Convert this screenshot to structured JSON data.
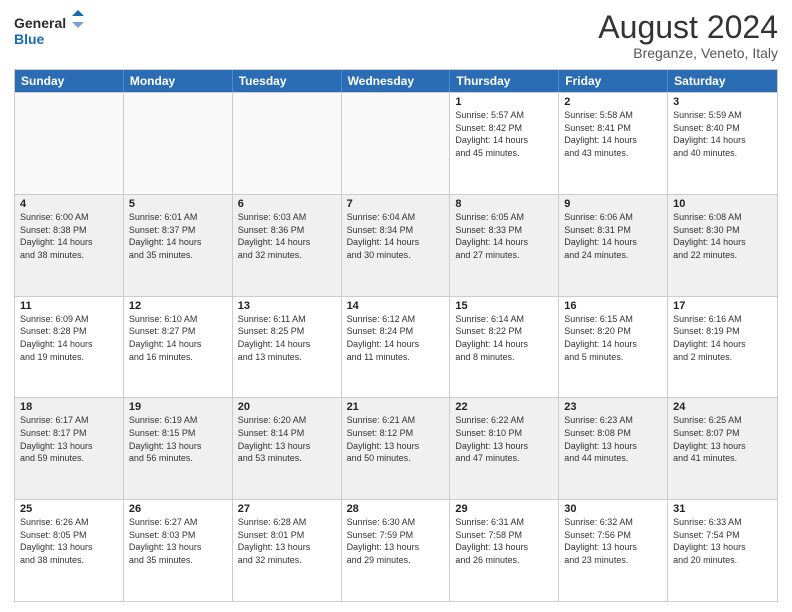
{
  "logo": {
    "line1": "General",
    "line2": "Blue"
  },
  "title": "August 2024",
  "location": "Breganze, Veneto, Italy",
  "days_of_week": [
    "Sunday",
    "Monday",
    "Tuesday",
    "Wednesday",
    "Thursday",
    "Friday",
    "Saturday"
  ],
  "weeks": [
    [
      {
        "day": "",
        "info": ""
      },
      {
        "day": "",
        "info": ""
      },
      {
        "day": "",
        "info": ""
      },
      {
        "day": "",
        "info": ""
      },
      {
        "day": "1",
        "info": "Sunrise: 5:57 AM\nSunset: 8:42 PM\nDaylight: 14 hours\nand 45 minutes."
      },
      {
        "day": "2",
        "info": "Sunrise: 5:58 AM\nSunset: 8:41 PM\nDaylight: 14 hours\nand 43 minutes."
      },
      {
        "day": "3",
        "info": "Sunrise: 5:59 AM\nSunset: 8:40 PM\nDaylight: 14 hours\nand 40 minutes."
      }
    ],
    [
      {
        "day": "4",
        "info": "Sunrise: 6:00 AM\nSunset: 8:38 PM\nDaylight: 14 hours\nand 38 minutes."
      },
      {
        "day": "5",
        "info": "Sunrise: 6:01 AM\nSunset: 8:37 PM\nDaylight: 14 hours\nand 35 minutes."
      },
      {
        "day": "6",
        "info": "Sunrise: 6:03 AM\nSunset: 8:36 PM\nDaylight: 14 hours\nand 32 minutes."
      },
      {
        "day": "7",
        "info": "Sunrise: 6:04 AM\nSunset: 8:34 PM\nDaylight: 14 hours\nand 30 minutes."
      },
      {
        "day": "8",
        "info": "Sunrise: 6:05 AM\nSunset: 8:33 PM\nDaylight: 14 hours\nand 27 minutes."
      },
      {
        "day": "9",
        "info": "Sunrise: 6:06 AM\nSunset: 8:31 PM\nDaylight: 14 hours\nand 24 minutes."
      },
      {
        "day": "10",
        "info": "Sunrise: 6:08 AM\nSunset: 8:30 PM\nDaylight: 14 hours\nand 22 minutes."
      }
    ],
    [
      {
        "day": "11",
        "info": "Sunrise: 6:09 AM\nSunset: 8:28 PM\nDaylight: 14 hours\nand 19 minutes."
      },
      {
        "day": "12",
        "info": "Sunrise: 6:10 AM\nSunset: 8:27 PM\nDaylight: 14 hours\nand 16 minutes."
      },
      {
        "day": "13",
        "info": "Sunrise: 6:11 AM\nSunset: 8:25 PM\nDaylight: 14 hours\nand 13 minutes."
      },
      {
        "day": "14",
        "info": "Sunrise: 6:12 AM\nSunset: 8:24 PM\nDaylight: 14 hours\nand 11 minutes."
      },
      {
        "day": "15",
        "info": "Sunrise: 6:14 AM\nSunset: 8:22 PM\nDaylight: 14 hours\nand 8 minutes."
      },
      {
        "day": "16",
        "info": "Sunrise: 6:15 AM\nSunset: 8:20 PM\nDaylight: 14 hours\nand 5 minutes."
      },
      {
        "day": "17",
        "info": "Sunrise: 6:16 AM\nSunset: 8:19 PM\nDaylight: 14 hours\nand 2 minutes."
      }
    ],
    [
      {
        "day": "18",
        "info": "Sunrise: 6:17 AM\nSunset: 8:17 PM\nDaylight: 13 hours\nand 59 minutes."
      },
      {
        "day": "19",
        "info": "Sunrise: 6:19 AM\nSunset: 8:15 PM\nDaylight: 13 hours\nand 56 minutes."
      },
      {
        "day": "20",
        "info": "Sunrise: 6:20 AM\nSunset: 8:14 PM\nDaylight: 13 hours\nand 53 minutes."
      },
      {
        "day": "21",
        "info": "Sunrise: 6:21 AM\nSunset: 8:12 PM\nDaylight: 13 hours\nand 50 minutes."
      },
      {
        "day": "22",
        "info": "Sunrise: 6:22 AM\nSunset: 8:10 PM\nDaylight: 13 hours\nand 47 minutes."
      },
      {
        "day": "23",
        "info": "Sunrise: 6:23 AM\nSunset: 8:08 PM\nDaylight: 13 hours\nand 44 minutes."
      },
      {
        "day": "24",
        "info": "Sunrise: 6:25 AM\nSunset: 8:07 PM\nDaylight: 13 hours\nand 41 minutes."
      }
    ],
    [
      {
        "day": "25",
        "info": "Sunrise: 6:26 AM\nSunset: 8:05 PM\nDaylight: 13 hours\nand 38 minutes."
      },
      {
        "day": "26",
        "info": "Sunrise: 6:27 AM\nSunset: 8:03 PM\nDaylight: 13 hours\nand 35 minutes."
      },
      {
        "day": "27",
        "info": "Sunrise: 6:28 AM\nSunset: 8:01 PM\nDaylight: 13 hours\nand 32 minutes."
      },
      {
        "day": "28",
        "info": "Sunrise: 6:30 AM\nSunset: 7:59 PM\nDaylight: 13 hours\nand 29 minutes."
      },
      {
        "day": "29",
        "info": "Sunrise: 6:31 AM\nSunset: 7:58 PM\nDaylight: 13 hours\nand 26 minutes."
      },
      {
        "day": "30",
        "info": "Sunrise: 6:32 AM\nSunset: 7:56 PM\nDaylight: 13 hours\nand 23 minutes."
      },
      {
        "day": "31",
        "info": "Sunrise: 6:33 AM\nSunset: 7:54 PM\nDaylight: 13 hours\nand 20 minutes."
      }
    ]
  ]
}
